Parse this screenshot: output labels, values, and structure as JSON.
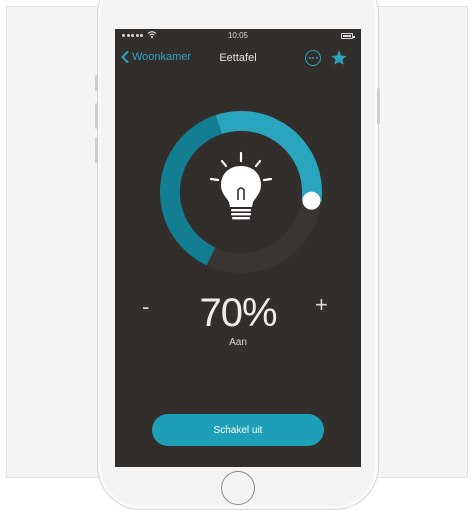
{
  "status_bar": {
    "time": "10:05"
  },
  "nav": {
    "back_label": "Woonkamer",
    "title": "Eettafel"
  },
  "light": {
    "level_text": "70%",
    "level": 0.7,
    "state": "Aan",
    "minus_label": "-",
    "plus_label": "+"
  },
  "actions": {
    "switch_off_label": "Schakel uit"
  },
  "colors": {
    "accent": "#2aa5be",
    "accent_dark": "#137d92",
    "background": "#322e2b"
  },
  "icons": {
    "back": "chevron-left-icon",
    "more": "ellipsis-circle-icon",
    "favorite": "star-icon",
    "bulb": "light-bulb-icon"
  }
}
